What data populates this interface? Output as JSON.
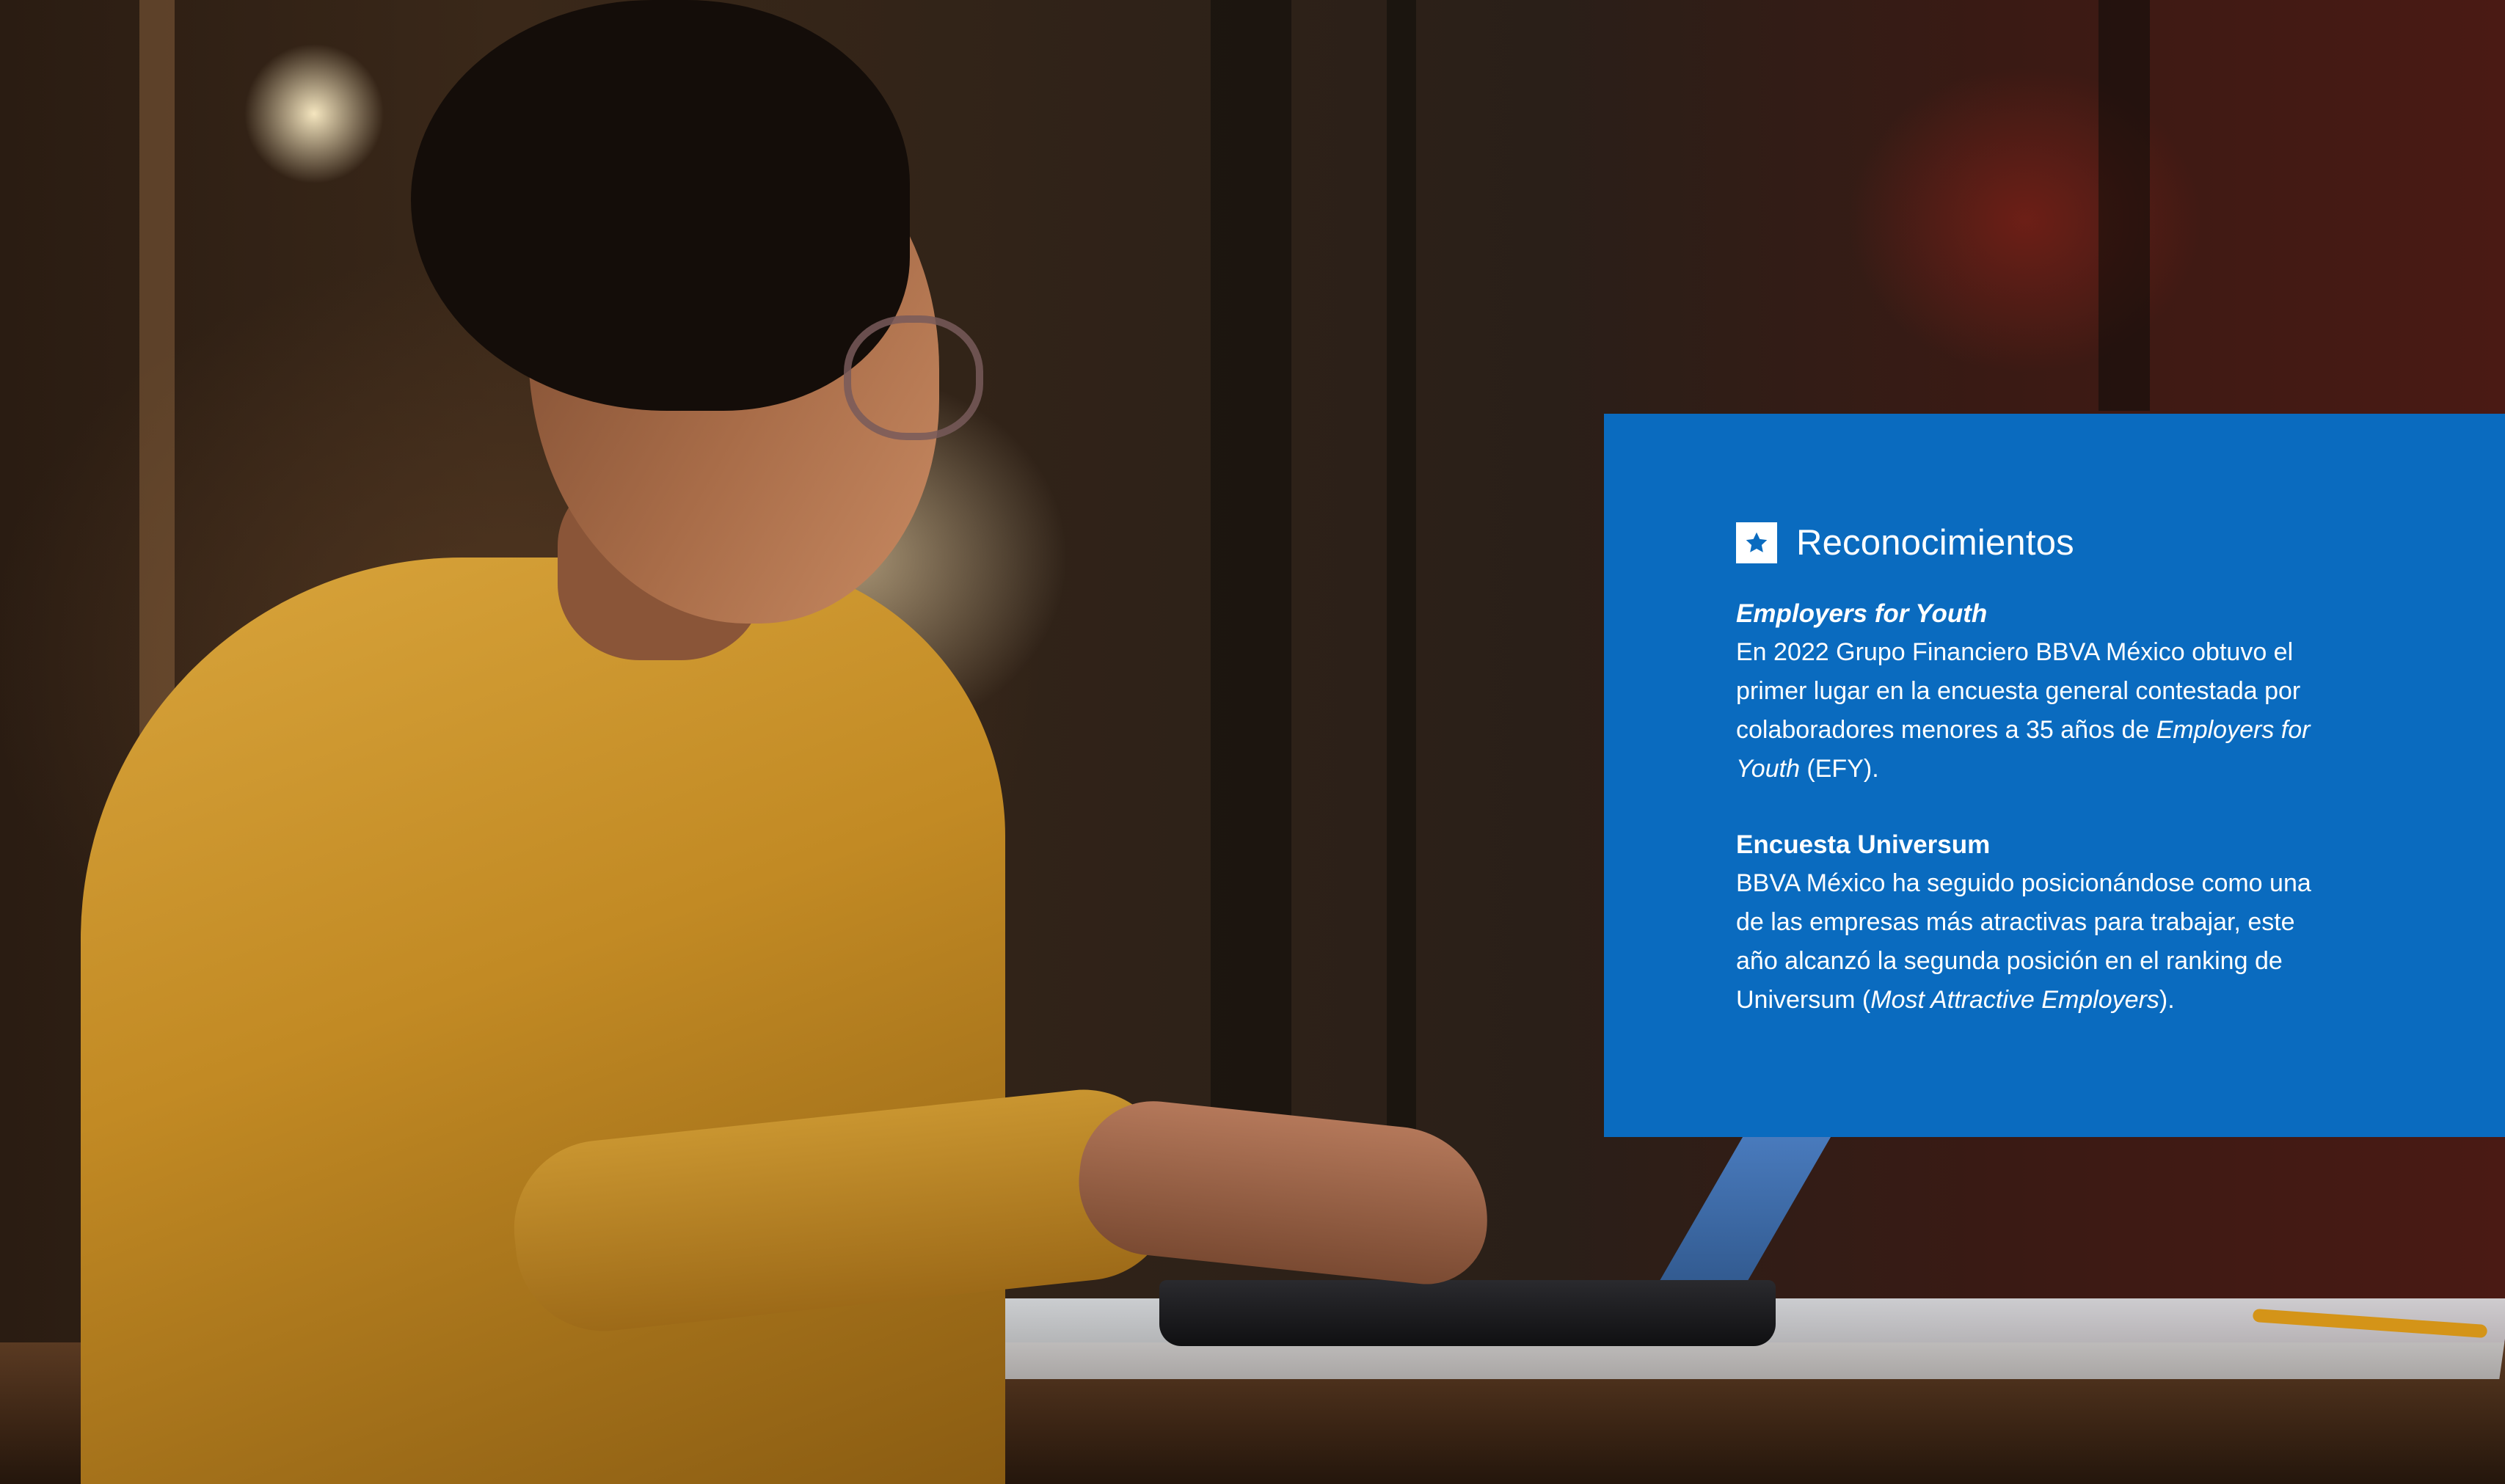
{
  "card": {
    "icon": "star-icon",
    "title": "Reconocimientos",
    "background_color": "#0a6bbf",
    "items": [
      {
        "title": "Employers for Youth",
        "title_italic": true,
        "body_parts": [
          {
            "text": "En 2022 Grupo Financiero BBVA México obtuvo el primer lugar en la encuesta general contestada por colaboradores menores a 35 años de ",
            "italic": false
          },
          {
            "text": "Employers for Youth",
            "italic": true
          },
          {
            "text": " (EFY).",
            "italic": false
          }
        ]
      },
      {
        "title": "Encuesta Universum",
        "title_italic": false,
        "body_parts": [
          {
            "text": "BBVA México ha seguido posicionándose como una de las empresas más atractivas para trabajar, este año alcanzó la segunda posición en el ranking de Universum (",
            "italic": false
          },
          {
            "text": "Most Attractive Employers",
            "italic": true
          },
          {
            "text": ").",
            "italic": false
          }
        ]
      }
    ]
  }
}
